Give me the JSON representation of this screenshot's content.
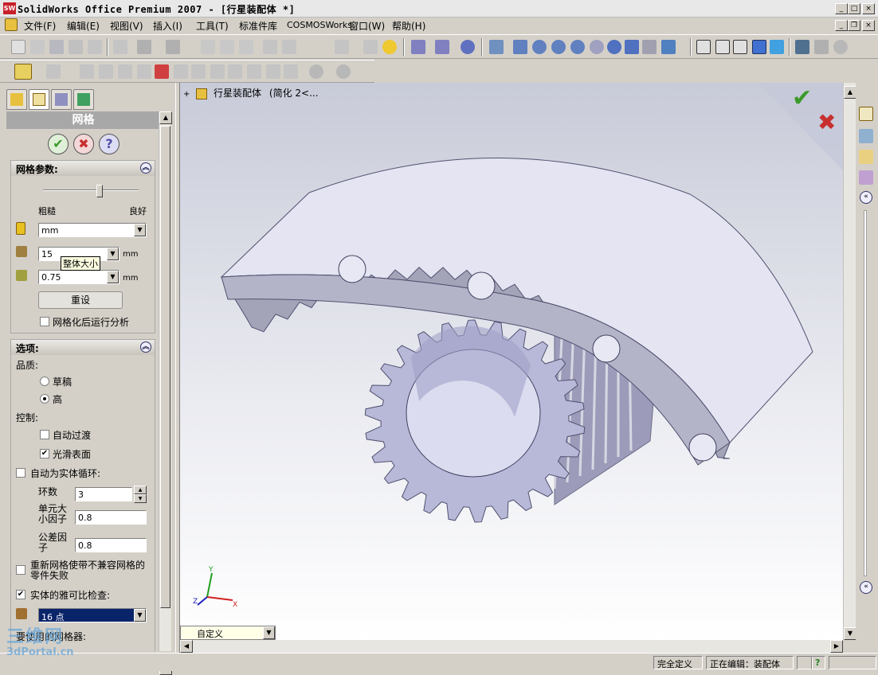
{
  "app": {
    "title": "SolidWorks Office Premium 2007 - [行星装配体 *]",
    "logo_text": "SW"
  },
  "menu": [
    "文件(F)",
    "编辑(E)",
    "视图(V)",
    "插入(I)",
    "工具(T)",
    "标准件库",
    "COSMOSWorks",
    "窗口(W)",
    "帮助(H)"
  ],
  "tree": {
    "root": "行星装配体",
    "suffix": "(简化  2<..."
  },
  "panel": {
    "title": "网格",
    "params": {
      "heading": "网格参数:",
      "coarse": "粗糙",
      "fine": "良好",
      "slider_position": 0.6,
      "unit_value": "mm",
      "size_value": "15",
      "size_unit": "mm",
      "size_tooltip": "整体大小",
      "tol_value": "0.75",
      "tol_unit": "mm",
      "reset_label": "重设",
      "run_after_label": "网格化后运行分析",
      "run_after_checked": false
    },
    "options": {
      "heading": "选项:",
      "quality_label": "品质:",
      "draft_label": "草稿",
      "high_label": "高",
      "quality_selected": "高",
      "control_label": "控制:",
      "auto_transition_label": "自动过渡",
      "auto_transition_checked": false,
      "smooth_surface_label": "光滑表面",
      "smooth_surface_checked": true,
      "auto_loop_label": "自动为实体循环:",
      "auto_loop_checked": false,
      "loops_label": "环数",
      "loops_value": "3",
      "elem_factor_label": "单元大小因子",
      "elem_factor_value": "0.8",
      "tol_factor_label": "公差因子",
      "tol_factor_value": "0.8",
      "remesh_label": "重新网格使带不兼容网格的零件失败",
      "remesh_checked": false,
      "jacobian_label": "实体的雅可比检查:",
      "jacobian_checked": true,
      "jacobian_value": "16 点",
      "cutoff_label": "要使用的网格器:"
    }
  },
  "viewport": {
    "view_select": "自定义",
    "triad": {
      "x": "X",
      "y": "Y",
      "z": "Z"
    }
  },
  "status": {
    "defined": "完全定义",
    "editing": "正在编辑：装配体",
    "help": "?"
  },
  "watermark": {
    "line1": "三维网",
    "line2": "3dPortal.cn"
  },
  "colors": {
    "accept": "#3a9a2a",
    "cancel": "#c83030",
    "help": "#5050a8",
    "gear": "#b8b9d8",
    "gear_edge": "#9c9cba",
    "ring_top": "#e4e4f2",
    "ring_side": "#a4a4b8"
  }
}
